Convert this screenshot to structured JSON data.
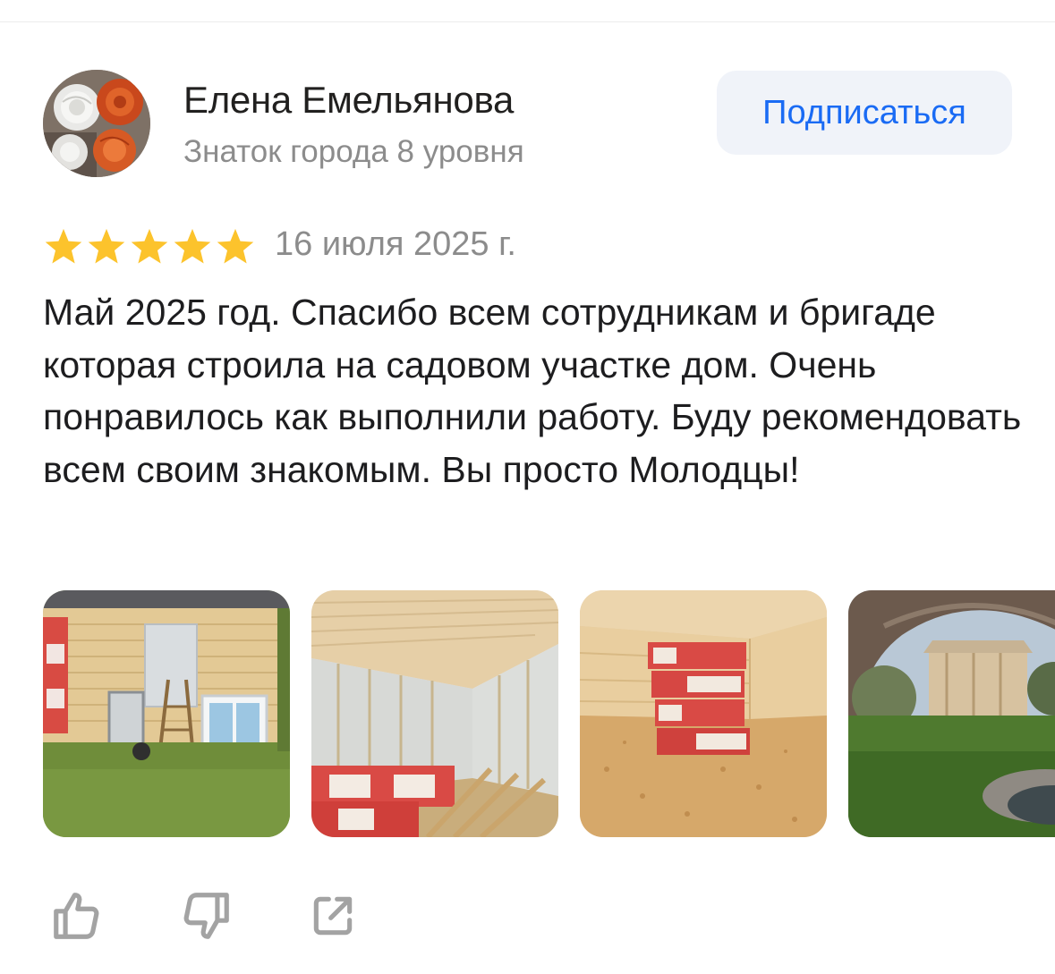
{
  "author": {
    "name": "Елена Емельянова",
    "level": "Знаток города 8 уровня",
    "avatar_icon": "avatar-roses"
  },
  "subscribe_label": "Подписаться",
  "review": {
    "rating": 5,
    "rating_max": 5,
    "date": "16 июля 2025 г.",
    "text": "Май 2025 год. Спасибо всем сотрудникам и бригаде которая строила на садовом участке дом. Очень понравилось как выполнили работу. Буду рекомендовать всем своим знакомым. Вы просто Молодцы!"
  },
  "photos": [
    {
      "icon": "photo-house-exterior"
    },
    {
      "icon": "photo-interior-insulation"
    },
    {
      "icon": "photo-insulation-packs"
    },
    {
      "icon": "photo-garden-frame"
    }
  ],
  "actions": [
    {
      "icon": "thumbs-up-icon"
    },
    {
      "icon": "thumbs-down-icon"
    },
    {
      "icon": "share-icon"
    }
  ],
  "colors": {
    "accent": "#1a6bf4",
    "button_bg": "#f0f3f9",
    "star": "#fcc32c",
    "secondary_text": "#8c8c8c",
    "icon": "#a3a3a3"
  }
}
